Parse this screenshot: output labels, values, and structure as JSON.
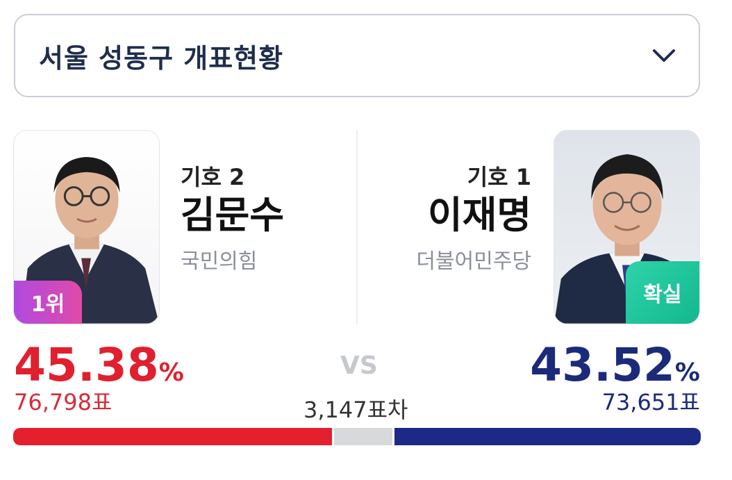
{
  "header": {
    "title": "서울 성동구 개표현황"
  },
  "candidates": {
    "left": {
      "number_label": "기호 2",
      "name": "김문수",
      "party": "국민의힘",
      "rank_badge": "1위",
      "percent": "45.38",
      "percent_unit": "%",
      "votes_label": "76,798표",
      "color": "#e0202f"
    },
    "right": {
      "number_label": "기호 1",
      "name": "이재명",
      "party": "더불어민주당",
      "status_badge": "확실",
      "percent": "43.52",
      "percent_unit": "%",
      "votes_label": "73,651표",
      "color": "#1c2a7a"
    }
  },
  "comparison": {
    "vs_label": "VS",
    "diff_label": "3,147표차"
  },
  "bar": {
    "left_share": 45.38,
    "gap_share": 8.28,
    "right_share": 43.52
  },
  "icons": {
    "dropdown": "chevron-down-icon"
  }
}
